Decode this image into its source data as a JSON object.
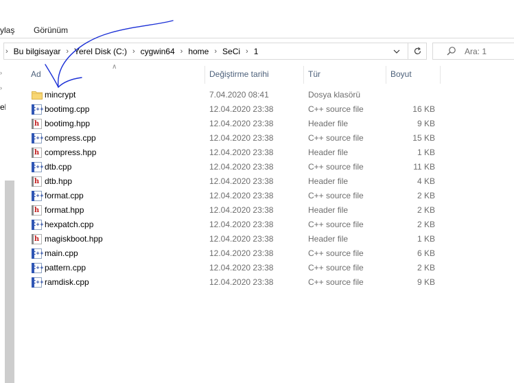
{
  "ribbon": {
    "tabs": [
      "ylaş",
      "Görünüm"
    ]
  },
  "address_bar": {
    "crumbs": [
      "Bu bilgisayar",
      "Yerel Disk (C:)",
      "cygwin64",
      "home",
      "SeCi",
      "1"
    ],
    "separator_icon": "chevron-right-icon",
    "dropdown_icon": "chevron-down-icon",
    "refresh_icon": "refresh-icon"
  },
  "search": {
    "placeholder": "Ara: 1",
    "icon": "search-icon"
  },
  "nav_pane": {
    "visible_fragments": [
      "el"
    ]
  },
  "columns": {
    "name": "Ad",
    "date": "Değiştirme tarihi",
    "type": "Tür",
    "size": "Boyut"
  },
  "files": [
    {
      "name": "mincrypt",
      "date": "7.04.2020 08:41",
      "type": "Dosya klasörü",
      "size": "",
      "icon": "folder-icon"
    },
    {
      "name": "bootimg.cpp",
      "date": "12.04.2020 23:38",
      "type": "C++ source file",
      "size": "16 KB",
      "icon": "cpp-file-icon"
    },
    {
      "name": "bootimg.hpp",
      "date": "12.04.2020 23:38",
      "type": "Header file",
      "size": "9 KB",
      "icon": "header-file-icon"
    },
    {
      "name": "compress.cpp",
      "date": "12.04.2020 23:38",
      "type": "C++ source file",
      "size": "15 KB",
      "icon": "cpp-file-icon"
    },
    {
      "name": "compress.hpp",
      "date": "12.04.2020 23:38",
      "type": "Header file",
      "size": "1 KB",
      "icon": "header-file-icon"
    },
    {
      "name": "dtb.cpp",
      "date": "12.04.2020 23:38",
      "type": "C++ source file",
      "size": "11 KB",
      "icon": "cpp-file-icon"
    },
    {
      "name": "dtb.hpp",
      "date": "12.04.2020 23:38",
      "type": "Header file",
      "size": "4 KB",
      "icon": "header-file-icon"
    },
    {
      "name": "format.cpp",
      "date": "12.04.2020 23:38",
      "type": "C++ source file",
      "size": "2 KB",
      "icon": "cpp-file-icon"
    },
    {
      "name": "format.hpp",
      "date": "12.04.2020 23:38",
      "type": "Header file",
      "size": "2 KB",
      "icon": "header-file-icon"
    },
    {
      "name": "hexpatch.cpp",
      "date": "12.04.2020 23:38",
      "type": "C++ source file",
      "size": "2 KB",
      "icon": "cpp-file-icon"
    },
    {
      "name": "magiskboot.hpp",
      "date": "12.04.2020 23:38",
      "type": "Header file",
      "size": "1 KB",
      "icon": "header-file-icon"
    },
    {
      "name": "main.cpp",
      "date": "12.04.2020 23:38",
      "type": "C++ source file",
      "size": "6 KB",
      "icon": "cpp-file-icon"
    },
    {
      "name": "pattern.cpp",
      "date": "12.04.2020 23:38",
      "type": "C++ source file",
      "size": "2 KB",
      "icon": "cpp-file-icon"
    },
    {
      "name": "ramdisk.cpp",
      "date": "12.04.2020 23:38",
      "type": "C++ source file",
      "size": "9 KB",
      "icon": "cpp-file-icon"
    }
  ],
  "annotation": {
    "color": "#1a2fd6",
    "shape": "hand-drawn-arrow"
  }
}
